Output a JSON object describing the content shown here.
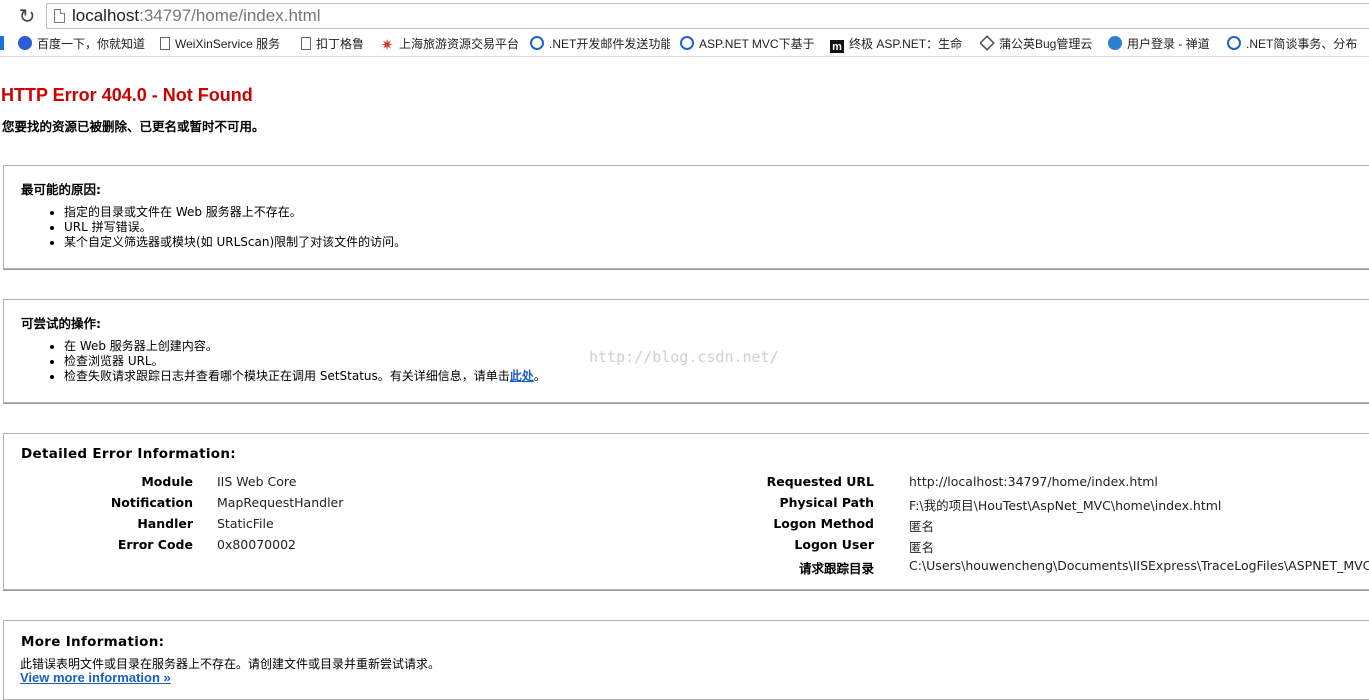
{
  "browser": {
    "reload_icon": "reload-icon",
    "address": "localhost",
    "address_rest": ":34797/home/index.html",
    "bookmarks": [
      {
        "label": "百度一下，你就知道",
        "icon": "paw-icon"
      },
      {
        "label": "WeiXinService 服务",
        "icon": "page-icon"
      },
      {
        "label": "扣丁格鲁",
        "icon": "page-icon"
      },
      {
        "label": "上海旅游资源交易平台",
        "icon": "star-icon"
      },
      {
        "label": ".NET开发邮件发送功能",
        "icon": "csdn-icon"
      },
      {
        "label": "ASP.NET MVC下基于",
        "icon": "csdn-icon"
      },
      {
        "label": "终极 ASP.NET：生命",
        "icon": "m-icon"
      },
      {
        "label": "蒲公英Bug管理云",
        "icon": "cube-icon"
      },
      {
        "label": "用户登录 - 禅道",
        "icon": "globe-icon"
      },
      {
        "label": ".NET简谈事务、分布",
        "icon": "csdn-icon"
      }
    ]
  },
  "page": {
    "title": "HTTP Error 404.0 - Not Found",
    "subtitle": "您要找的资源已被删除、已更名或暂时不可用。",
    "causes": {
      "heading": "最可能的原因:",
      "items": [
        "指定的目录或文件在 Web 服务器上不存在。",
        "URL 拼写错误。",
        "某个自定义筛选器或模块(如 URLScan)限制了对该文件的访问。"
      ]
    },
    "actions": {
      "heading": "可尝试的操作:",
      "items": [
        "在 Web 服务器上创建内容。",
        "检查浏览器 URL。"
      ],
      "last_prefix": "检查失败请求跟踪日志并查看哪个模块正在调用 SetStatus。有关详细信息，请单击",
      "last_link": "此处",
      "last_suffix": "。"
    },
    "details": {
      "heading": "Detailed Error Information:",
      "left": [
        {
          "key": "Module",
          "value": "IIS Web Core"
        },
        {
          "key": "Notification",
          "value": "MapRequestHandler"
        },
        {
          "key": "Handler",
          "value": "StaticFile"
        },
        {
          "key": "Error Code",
          "value": "0x80070002"
        }
      ],
      "right": [
        {
          "key": "Requested URL",
          "value": "http://localhost:34797/home/index.html"
        },
        {
          "key": "Physical Path",
          "value": "F:\\我的项目\\HouTest\\AspNet_MVC\\home\\index.html"
        },
        {
          "key": "Logon Method",
          "value": "匿名"
        },
        {
          "key": "Logon User",
          "value": "匿名"
        },
        {
          "key": "请求跟踪目录",
          "value": "C:\\Users\\houwencheng\\Documents\\IISExpress\\TraceLogFiles\\ASPNET_MVC"
        }
      ]
    },
    "more": {
      "heading": "More Information:",
      "text": "此错误表明文件或目录在服务器上不存在。请创建文件或目录并重新尝试请求。",
      "link": "View more information »"
    },
    "watermark": "http://blog.csdn.net/"
  }
}
